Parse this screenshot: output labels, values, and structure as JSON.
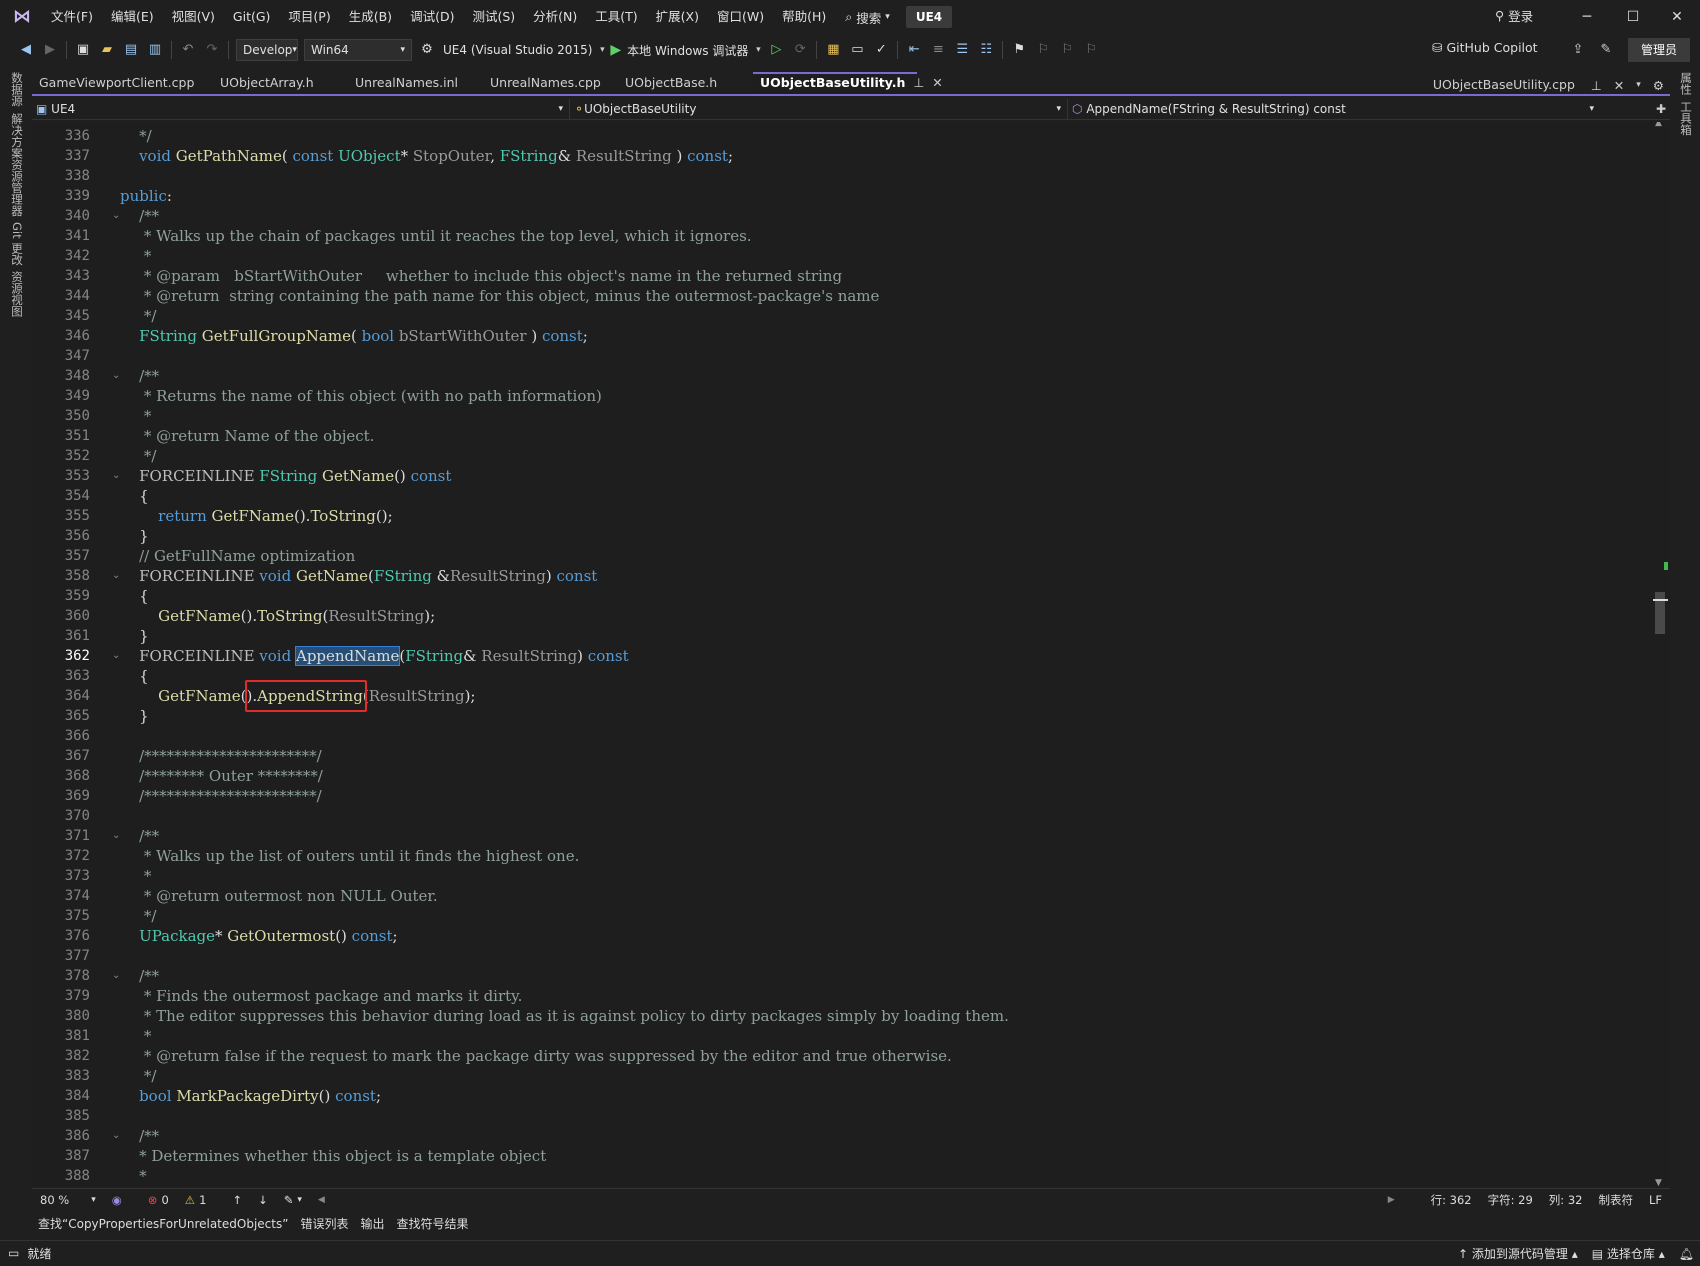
{
  "menu": {
    "items": [
      "文件(F)",
      "编辑(E)",
      "视图(V)",
      "Git(G)",
      "项目(P)",
      "生成(B)",
      "调试(D)",
      "测试(S)",
      "分析(N)",
      "工具(T)",
      "扩展(X)",
      "窗口(W)",
      "帮助(H)"
    ],
    "search": "搜索",
    "solution": "UE4",
    "login": "登录"
  },
  "toolbar": {
    "config": "Develop",
    "platform": "Win64",
    "startup": "UE4 (Visual Studio 2015)",
    "debugger": "本地 Windows 调试器",
    "copilot": "GitHub Copilot",
    "admin": "管理员"
  },
  "leftrail": [
    "数据源",
    "解决方案资源管理器",
    "Git 更改",
    "资源视图"
  ],
  "rightrail": [
    "属性",
    "工具箱"
  ],
  "tabs": [
    {
      "label": "GameViewportClient.cpp"
    },
    {
      "label": "UObjectArray.h"
    },
    {
      "label": "UnrealNames.inl"
    },
    {
      "label": "UnrealNames.cpp"
    },
    {
      "label": "UObjectBase.h"
    },
    {
      "label": "UObjectBaseUtility.h",
      "active": true
    }
  ],
  "tab_right": "UObjectBaseUtility.cpp",
  "nav": {
    "project": "UE4",
    "scope": "UObjectBaseUtility",
    "member": "AppendName(FString & ResultString) const"
  },
  "status": {
    "zoom": "80 %",
    "errors": "0",
    "warnings": "1",
    "line": "行: 362",
    "char": "字符: 29",
    "col": "列: 32",
    "tabs": "制表符",
    "eol": "LF"
  },
  "bottom_tabs": [
    "查找“CopyPropertiesForUnrelatedObjects”",
    "错误列表",
    "输出",
    "查找符号结果"
  ],
  "statusbar": {
    "ready": "就绪",
    "source_control": "添加到源代码管理",
    "repo": "选择仓库"
  },
  "code": [
    {
      "n": "336",
      "t": [
        [
          "cmt",
          "    */"
        ]
      ]
    },
    {
      "n": "337",
      "t": [
        [
          "pl",
          "    "
        ],
        [
          "kw",
          "void "
        ],
        [
          "fn",
          "GetPathName"
        ],
        [
          "pl",
          "( "
        ],
        [
          "kw",
          "const "
        ],
        [
          "ty",
          "UObject"
        ],
        [
          "pl",
          "* "
        ],
        [
          "pm",
          "StopOuter"
        ],
        [
          "pl",
          ", "
        ],
        [
          "ty",
          "FString"
        ],
        [
          "pl",
          "& "
        ],
        [
          "pm",
          "ResultString"
        ],
        [
          "pl",
          " ) "
        ],
        [
          "kw",
          "const"
        ],
        [
          "pl",
          ";"
        ]
      ]
    },
    {
      "n": "338",
      "t": []
    },
    {
      "n": "339",
      "t": [
        [
          "kw",
          "public"
        ],
        [
          "pl",
          ":"
        ]
      ]
    },
    {
      "n": "340",
      "f": true,
      "t": [
        [
          "cmt",
          "    /**"
        ]
      ]
    },
    {
      "n": "341",
      "t": [
        [
          "cmt",
          "     * Walks up the chain of packages until it reaches the top level, which it ignores."
        ]
      ]
    },
    {
      "n": "342",
      "t": [
        [
          "cmt",
          "     *"
        ]
      ]
    },
    {
      "n": "343",
      "t": [
        [
          "cmt",
          "     * @param   bStartWithOuter     whether to include this object's name in the returned string"
        ]
      ]
    },
    {
      "n": "344",
      "t": [
        [
          "cmt",
          "     * @return  string containing the path name for this object, minus the outermost-package's name"
        ]
      ]
    },
    {
      "n": "345",
      "t": [
        [
          "cmt",
          "     */"
        ]
      ]
    },
    {
      "n": "346",
      "t": [
        [
          "pl",
          "    "
        ],
        [
          "ty",
          "FString "
        ],
        [
          "fn",
          "GetFullGroupName"
        ],
        [
          "pl",
          "( "
        ],
        [
          "kw",
          "bool "
        ],
        [
          "pm",
          "bStartWithOuter"
        ],
        [
          "pl",
          " ) "
        ],
        [
          "kw",
          "const"
        ],
        [
          "pl",
          ";"
        ]
      ]
    },
    {
      "n": "347",
      "t": []
    },
    {
      "n": "348",
      "f": true,
      "t": [
        [
          "cmt",
          "    /**"
        ]
      ]
    },
    {
      "n": "349",
      "t": [
        [
          "cmt",
          "     * Returns the name of this object (with no path information)"
        ]
      ]
    },
    {
      "n": "350",
      "t": [
        [
          "cmt",
          "     *"
        ]
      ]
    },
    {
      "n": "351",
      "t": [
        [
          "cmt",
          "     * @return Name of the object."
        ]
      ]
    },
    {
      "n": "352",
      "t": [
        [
          "cmt",
          "     */"
        ]
      ]
    },
    {
      "n": "353",
      "f": true,
      "t": [
        [
          "pl",
          "    "
        ],
        [
          "mac",
          "FORCEINLINE "
        ],
        [
          "ty",
          "FString "
        ],
        [
          "fn",
          "GetName"
        ],
        [
          "pl",
          "() "
        ],
        [
          "kw",
          "const"
        ]
      ]
    },
    {
      "n": "354",
      "t": [
        [
          "pl",
          "    {"
        ]
      ]
    },
    {
      "n": "355",
      "t": [
        [
          "pl",
          "        "
        ],
        [
          "kw",
          "return "
        ],
        [
          "fn",
          "GetFName"
        ],
        [
          "pl",
          "()."
        ],
        [
          "fn",
          "ToString"
        ],
        [
          "pl",
          "();"
        ]
      ]
    },
    {
      "n": "356",
      "t": [
        [
          "pl",
          "    }"
        ]
      ]
    },
    {
      "n": "357",
      "t": [
        [
          "cmt",
          "    // GetFullName optimization"
        ]
      ]
    },
    {
      "n": "358",
      "f": true,
      "t": [
        [
          "pl",
          "    "
        ],
        [
          "mac",
          "FORCEINLINE "
        ],
        [
          "kw",
          "void "
        ],
        [
          "fn",
          "GetName"
        ],
        [
          "pl",
          "("
        ],
        [
          "ty",
          "FString "
        ],
        [
          "pl",
          "&"
        ],
        [
          "pm",
          "ResultString"
        ],
        [
          "pl",
          ") "
        ],
        [
          "kw",
          "const"
        ]
      ]
    },
    {
      "n": "359",
      "t": [
        [
          "pl",
          "    {"
        ]
      ]
    },
    {
      "n": "360",
      "t": [
        [
          "pl",
          "        "
        ],
        [
          "fn",
          "GetFName"
        ],
        [
          "pl",
          "()."
        ],
        [
          "fn",
          "ToString"
        ],
        [
          "pl",
          "("
        ],
        [
          "pm",
          "ResultString"
        ],
        [
          "pl",
          ");"
        ]
      ]
    },
    {
      "n": "361",
      "t": [
        [
          "pl",
          "    }"
        ]
      ]
    },
    {
      "n": "362",
      "f": true,
      "cur": true,
      "t": [
        [
          "pl",
          "    "
        ],
        [
          "mac",
          "FORCEINLINE "
        ],
        [
          "kw",
          "void "
        ],
        [
          "sel",
          "AppendName"
        ],
        [
          "pl",
          "("
        ],
        [
          "ty",
          "FString"
        ],
        [
          "pl",
          "& "
        ],
        [
          "pm",
          "ResultString"
        ],
        [
          "pl",
          ") "
        ],
        [
          "kw",
          "const"
        ]
      ]
    },
    {
      "n": "363",
      "t": [
        [
          "pl",
          "    {"
        ]
      ]
    },
    {
      "n": "364",
      "t": [
        [
          "pl",
          "        "
        ],
        [
          "fn",
          "GetFName"
        ],
        [
          "pl",
          "()."
        ],
        [
          "fn",
          "AppendString"
        ],
        [
          "pl",
          "("
        ],
        [
          "pm",
          "ResultString"
        ],
        [
          "pl",
          ");"
        ]
      ]
    },
    {
      "n": "365",
      "t": [
        [
          "pl",
          "    }"
        ]
      ]
    },
    {
      "n": "366",
      "t": []
    },
    {
      "n": "367",
      "t": [
        [
          "cmt",
          "    /***********************/"
        ]
      ]
    },
    {
      "n": "368",
      "t": [
        [
          "cmt",
          "    /******** Outer ********/"
        ]
      ]
    },
    {
      "n": "369",
      "t": [
        [
          "cmt",
          "    /***********************/"
        ]
      ]
    },
    {
      "n": "370",
      "t": []
    },
    {
      "n": "371",
      "f": true,
      "t": [
        [
          "cmt",
          "    /**"
        ]
      ]
    },
    {
      "n": "372",
      "t": [
        [
          "cmt",
          "     * Walks up the list of outers until it finds the highest one."
        ]
      ]
    },
    {
      "n": "373",
      "t": [
        [
          "cmt",
          "     *"
        ]
      ]
    },
    {
      "n": "374",
      "t": [
        [
          "cmt",
          "     * @return outermost non NULL Outer."
        ]
      ]
    },
    {
      "n": "375",
      "t": [
        [
          "cmt",
          "     */"
        ]
      ]
    },
    {
      "n": "376",
      "t": [
        [
          "pl",
          "    "
        ],
        [
          "ty",
          "UPackage"
        ],
        [
          "pl",
          "* "
        ],
        [
          "fn",
          "GetOutermost"
        ],
        [
          "pl",
          "() "
        ],
        [
          "kw",
          "const"
        ],
        [
          "pl",
          ";"
        ]
      ]
    },
    {
      "n": "377",
      "t": []
    },
    {
      "n": "378",
      "f": true,
      "t": [
        [
          "cmt",
          "    /**"
        ]
      ]
    },
    {
      "n": "379",
      "t": [
        [
          "cmt",
          "     * Finds the outermost package and marks it dirty."
        ]
      ]
    },
    {
      "n": "380",
      "t": [
        [
          "cmt",
          "     * The editor suppresses this behavior during load as it is against policy to dirty packages simply by loading them."
        ]
      ]
    },
    {
      "n": "381",
      "t": [
        [
          "cmt",
          "     *"
        ]
      ]
    },
    {
      "n": "382",
      "t": [
        [
          "cmt",
          "     * @return false if the request to mark the package dirty was suppressed by the editor and true otherwise."
        ]
      ]
    },
    {
      "n": "383",
      "t": [
        [
          "cmt",
          "     */"
        ]
      ]
    },
    {
      "n": "384",
      "t": [
        [
          "pl",
          "    "
        ],
        [
          "kw",
          "bool "
        ],
        [
          "fn",
          "MarkPackageDirty"
        ],
        [
          "pl",
          "() "
        ],
        [
          "kw",
          "const"
        ],
        [
          "pl",
          ";"
        ]
      ]
    },
    {
      "n": "385",
      "t": []
    },
    {
      "n": "386",
      "f": true,
      "t": [
        [
          "cmt",
          "    /**"
        ]
      ]
    },
    {
      "n": "387",
      "t": [
        [
          "cmt",
          "    * Determines whether this object is a template object"
        ]
      ]
    },
    {
      "n": "388",
      "t": [
        [
          "cmt",
          "    *"
        ]
      ]
    }
  ]
}
